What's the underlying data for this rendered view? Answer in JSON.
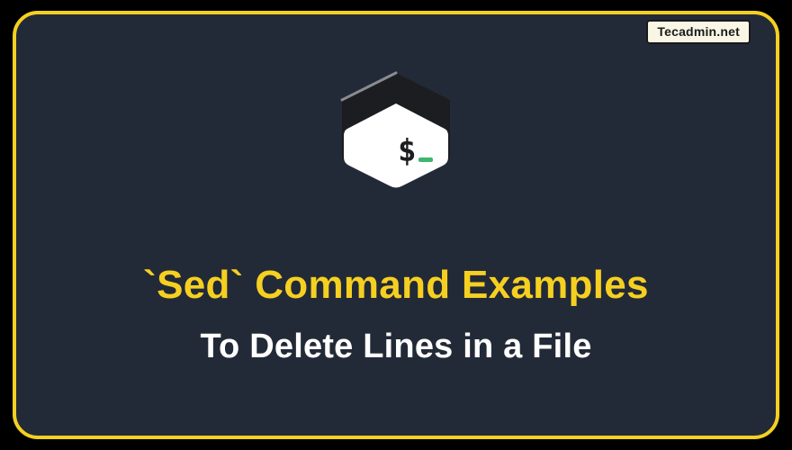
{
  "watermark": "Tecadmin.net",
  "title": "`Sed` Command Examples",
  "subtitle": "To Delete Lines in a File",
  "icon": {
    "prompt": "$",
    "cursor_color": "#3fb66f"
  }
}
